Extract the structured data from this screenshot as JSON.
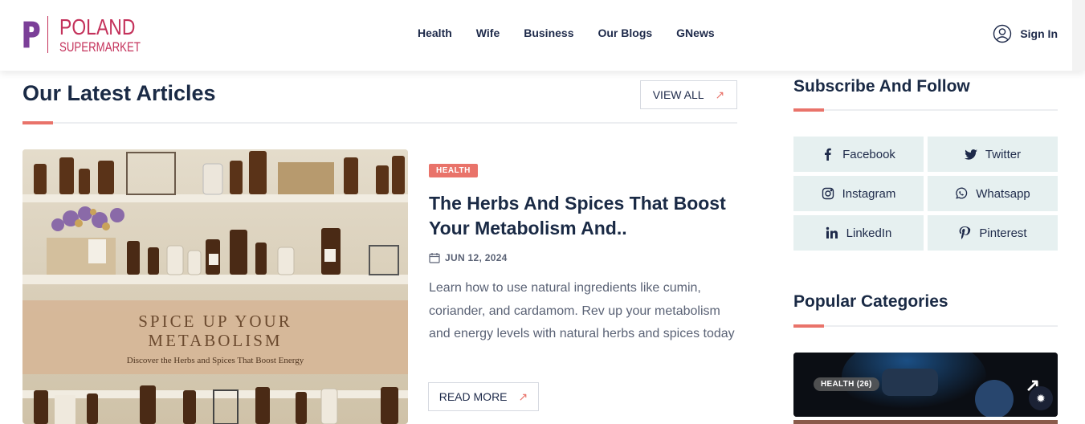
{
  "header": {
    "logo": {
      "line1": "POLAND",
      "line2": "SUPERMARKET",
      "letter": "P"
    },
    "nav": [
      "Health",
      "Wife",
      "Business",
      "Our Blogs",
      "GNews"
    ],
    "signin_label": "Sign In"
  },
  "main": {
    "section_title": "Our Latest Articles",
    "view_all_label": "VIEW ALL",
    "article": {
      "category": "HEALTH",
      "title": "The Herbs And Spices That Boost Your Metabolism And..",
      "date": "JUN 12, 2024",
      "excerpt": "Learn how to use natural ingredients like cumin, coriander, and cardamom. Rev up your metabolism and energy levels with natural herbs and spices today",
      "read_more_label": "READ MORE",
      "image": {
        "heading_line1": "SPICE UP YOUR",
        "heading_line2": "METABOLISM",
        "subheading": "Discover the Herbs and Spices That Boost Energy"
      }
    }
  },
  "sidebar": {
    "subscribe_title": "Subscribe And Follow",
    "social": [
      {
        "label": "Facebook",
        "icon": "facebook-icon"
      },
      {
        "label": "Twitter",
        "icon": "twitter-icon"
      },
      {
        "label": "Instagram",
        "icon": "instagram-icon"
      },
      {
        "label": "Whatsapp",
        "icon": "whatsapp-icon"
      },
      {
        "label": "LinkedIn",
        "icon": "linkedin-icon"
      },
      {
        "label": "Pinterest",
        "icon": "pinterest-icon"
      }
    ],
    "categories_title": "Popular Categories",
    "category_card": {
      "label": "HEALTH (26)"
    }
  },
  "colors": {
    "accent": "#e9736a",
    "brand": "#c4325b",
    "logo_p": "#7b3f98",
    "text_dark": "#1a2a45",
    "social_bg": "#e6f0f0"
  }
}
